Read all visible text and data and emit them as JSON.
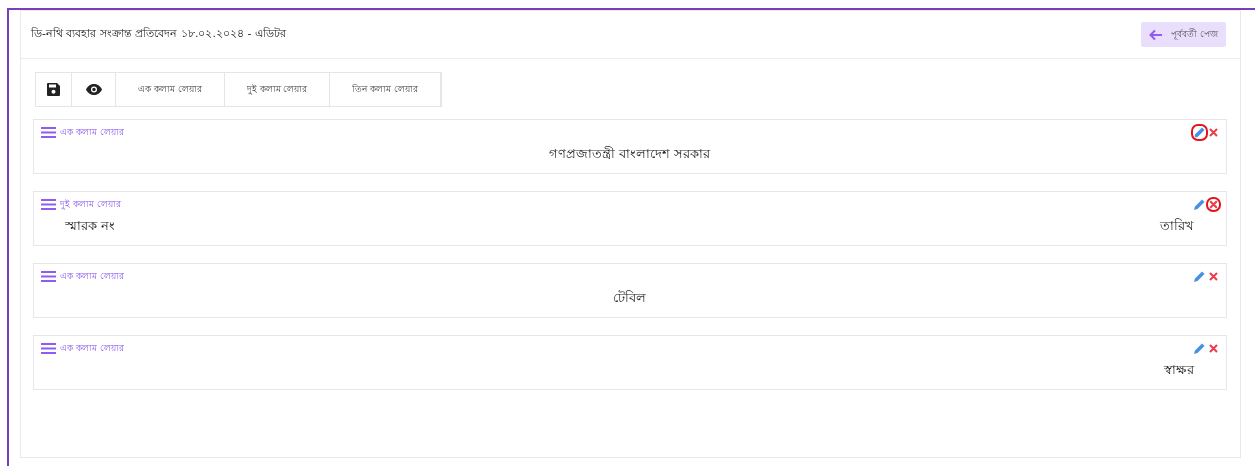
{
  "header": {
    "title": "ডি-নথি ব্যবহার সংক্রান্ত প্রতিবেদন ১৮.০২.২০২৪ - এডিটর",
    "back_button": "পূর্ববর্তী পেজ"
  },
  "toolbar": {
    "layouts": [
      "এক কলাম লেয়ার",
      "দুই কলাম লেয়ার",
      "তিন কলাম লেয়ার"
    ]
  },
  "blocks": [
    {
      "label": "এক কলাম লেয়ার",
      "kind": "centered",
      "edit_highlighted": true,
      "delete_highlighted": false,
      "cells": [
        "গণপ্রজাতন্ত্রী বাংলাদেশ সরকার"
      ]
    },
    {
      "label": "দুই কলাম লেয়ার",
      "kind": "split",
      "edit_highlighted": false,
      "delete_highlighted": true,
      "cells": [
        "স্মারক নং",
        "তারিখ"
      ]
    },
    {
      "label": "এক কলাম লেয়ার",
      "kind": "centered",
      "edit_highlighted": false,
      "delete_highlighted": false,
      "cells": [
        "টেবিল"
      ]
    },
    {
      "label": "এক কলাম লেয়ার",
      "kind": "right",
      "edit_highlighted": false,
      "delete_highlighted": false,
      "cells": [
        "স্বাক্ষর"
      ]
    }
  ]
}
